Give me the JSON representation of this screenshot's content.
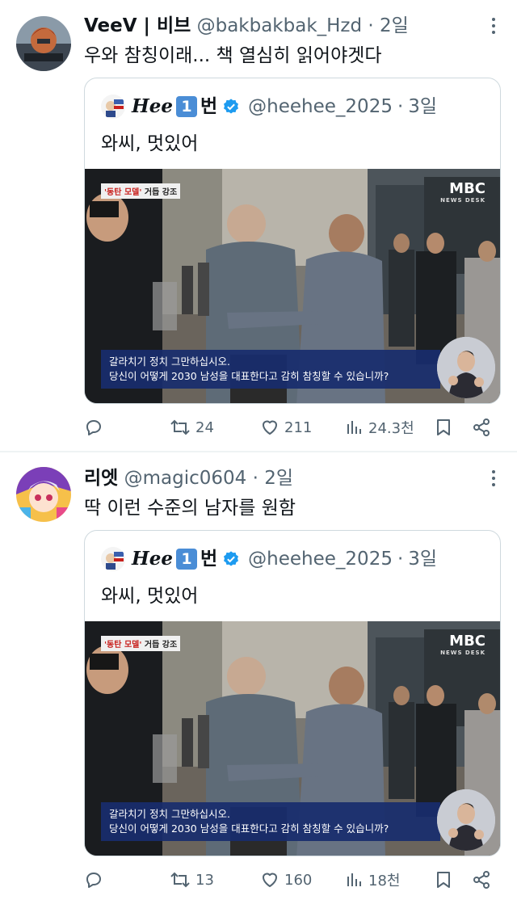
{
  "tweets": [
    {
      "display_name": "VeeV | 비브",
      "handle": "@bakbakbak_Hzd",
      "separator": "·",
      "time": "2일",
      "text": "우와 참칭이래... 책 열심히 읽어야겟다",
      "quote": {
        "display_name_script": "Hee",
        "display_name_num": "1",
        "display_name_suffix": "번",
        "handle": "@heehee_2025",
        "separator": "·",
        "time": "3일",
        "text": "와씨, 멋있어",
        "media": {
          "tag_highlight": "'동탄 모델'",
          "tag_rest": " 거듭 강조",
          "broadcaster": "MBC",
          "broadcaster_sub": "NEWS DESK",
          "subtitle_line1": "갈라치기 정치 그만하십시오.",
          "subtitle_line2": "당신이 어떻게 2030 남성을 대표한다고 감히 참칭할 수 있습니까?"
        }
      },
      "stats": {
        "replies": "",
        "retweets": "24",
        "likes": "211",
        "views": "24.3천"
      }
    },
    {
      "display_name": "리엣",
      "handle": "@magic0604",
      "separator": "·",
      "time": "2일",
      "text": "딱 이런 수준의 남자를 원함",
      "quote": {
        "display_name_script": "Hee",
        "display_name_num": "1",
        "display_name_suffix": "번",
        "handle": "@heehee_2025",
        "separator": "·",
        "time": "3일",
        "text": "와씨, 멋있어",
        "media": {
          "tag_highlight": "'동탄 모델'",
          "tag_rest": " 거듭 강조",
          "broadcaster": "MBC",
          "broadcaster_sub": "NEWS DESK",
          "subtitle_line1": "갈라치기 정치 그만하십시오.",
          "subtitle_line2": "당신이 어떻게 2030 남성을 대표한다고 감히 참칭할 수 있습니까?"
        }
      },
      "stats": {
        "replies": "",
        "retweets": "13",
        "likes": "160",
        "views": "18천"
      }
    }
  ],
  "icons": {
    "reply": "reply-icon",
    "retweet": "retweet-icon",
    "like": "heart-icon",
    "views": "views-chart-icon",
    "bookmark": "bookmark-icon",
    "share": "share-icon",
    "more": "more-dots-icon",
    "verified": "verified-badge-icon"
  },
  "colors": {
    "text_primary": "#0f1419",
    "text_secondary": "#536471",
    "verified_blue": "#1d9bf0",
    "border": "#cfd9de",
    "subtitle_bg": "#182d6e"
  }
}
